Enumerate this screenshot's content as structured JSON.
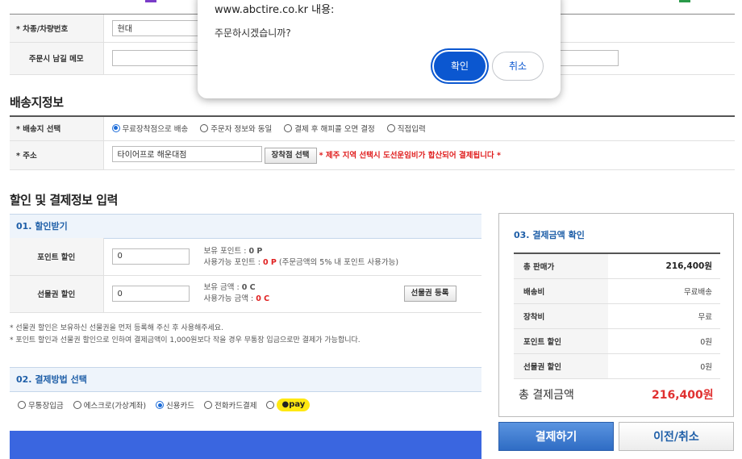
{
  "dialog": {
    "title": "www.abctire.co.kr 내용:",
    "message": "주문하시겠습니까?",
    "ok_label": "확인",
    "cancel_label": "취소"
  },
  "vehicle": {
    "model_label": "* 차종/차량번호",
    "model_value": "현대",
    "memo_label": "주문시 남길 메모",
    "memo_value": ""
  },
  "shipping": {
    "heading": "배송지정보",
    "select_label": "* 배송지 선택",
    "options": [
      "무료장착점으로 배송",
      "주문자 정보와 동일",
      "결제 후 해피콜 오면 결정",
      "직접입력"
    ],
    "selected_option": "무료장착점으로 배송",
    "address_label": "* 주소",
    "address_value": "타이어프로 해운대점",
    "select_shop_button": "장착점 선택",
    "jeju_notice": "* 제주 지역 선택시 도선운임비가 합산되어 결제됩니다 *"
  },
  "discount": {
    "heading": "할인 및 결제정보 입력",
    "section_title": "01. 할인받기",
    "point_label": "포인트 할인",
    "point_value": "0",
    "point_owned_label": "보유 포인트 :",
    "point_owned_value": "0 P",
    "point_usable_label": "사용가능 포인트 :",
    "point_usable_value": "0 P",
    "point_usable_note": "(주문금액의 5% 내 포인트 사용가능)",
    "gift_label": "선물권 할인",
    "gift_value": "0",
    "gift_owned_label": "보유 금액 :",
    "gift_owned_value": "0 C",
    "gift_usable_label": "사용가능 금액 :",
    "gift_usable_value": "0 C",
    "gift_register_button": "선물권 등록",
    "note1": "* 선물권 할인은 보유하신 선물권을 먼저 등록해 주신 후 사용해주세요.",
    "note2": "* 포인트 할인과 선물권 할인으로 인하여 결제금액이 1,000원보다 작을 경우 무통장 입금으로만 결제가 가능합니다."
  },
  "payment_method": {
    "section_title": "02. 결제방법 선택",
    "options": [
      "무통장입금",
      "에스크로(가상계좌)",
      "신용카드",
      "전화카드결제"
    ],
    "selected_option": "신용카드",
    "kakaopay_label": "pay"
  },
  "summary": {
    "title": "03. 결제금액 확인",
    "rows": [
      {
        "label": "총 판매가",
        "value": "216,400원"
      },
      {
        "label": "배송비",
        "value": "무료배송"
      },
      {
        "label": "장착비",
        "value": "무료"
      },
      {
        "label": "포인트 할인",
        "value": "0원"
      },
      {
        "label": "선물권 할인",
        "value": "0원"
      }
    ],
    "total_label": "총 결제금액",
    "total_value": "216,400원"
  },
  "buttons": {
    "pay": "결제하기",
    "prev_cancel": "이전/취소"
  },
  "colors": {
    "accent_blue": "#1f5fa8",
    "warning_red": "#e02020",
    "dialog_primary": "#0b57d0",
    "kakao_yellow": "#ffe812"
  }
}
